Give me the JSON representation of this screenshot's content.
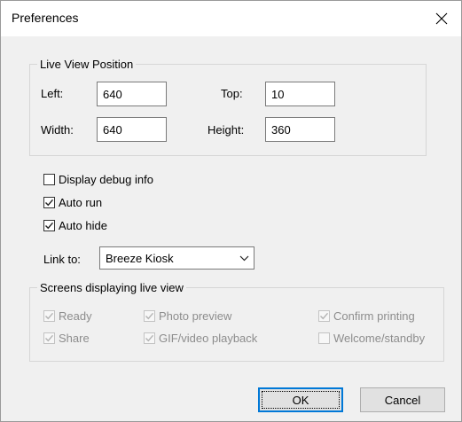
{
  "window": {
    "title": "Preferences"
  },
  "live_view_position": {
    "legend": "Live View Position",
    "left_label": "Left:",
    "left_value": "640",
    "top_label": "Top:",
    "top_value": "10",
    "width_label": "Width:",
    "width_value": "640",
    "height_label": "Height:",
    "height_value": "360"
  },
  "options": {
    "display_debug_label": "Display debug info",
    "display_debug_checked": false,
    "auto_run_label": "Auto run",
    "auto_run_checked": true,
    "auto_hide_label": "Auto hide",
    "auto_hide_checked": true
  },
  "link_to": {
    "label": "Link to:",
    "value": "Breeze Kiosk",
    "icon": "chevron-down-icon"
  },
  "screens": {
    "legend": "Screens displaying live view",
    "items": [
      {
        "label": "Ready",
        "checked": true
      },
      {
        "label": "Photo preview",
        "checked": true
      },
      {
        "label": "Confirm printing",
        "checked": true
      },
      {
        "label": "Share",
        "checked": true
      },
      {
        "label": "GIF/video playback",
        "checked": true
      },
      {
        "label": "Welcome/standby",
        "checked": false
      }
    ]
  },
  "buttons": {
    "ok_label": "OK",
    "cancel_label": "Cancel"
  },
  "colors": {
    "accent": "#0078d7",
    "disabled_text": "#8d8d8d",
    "dialog_bg": "#f0f0f0"
  }
}
